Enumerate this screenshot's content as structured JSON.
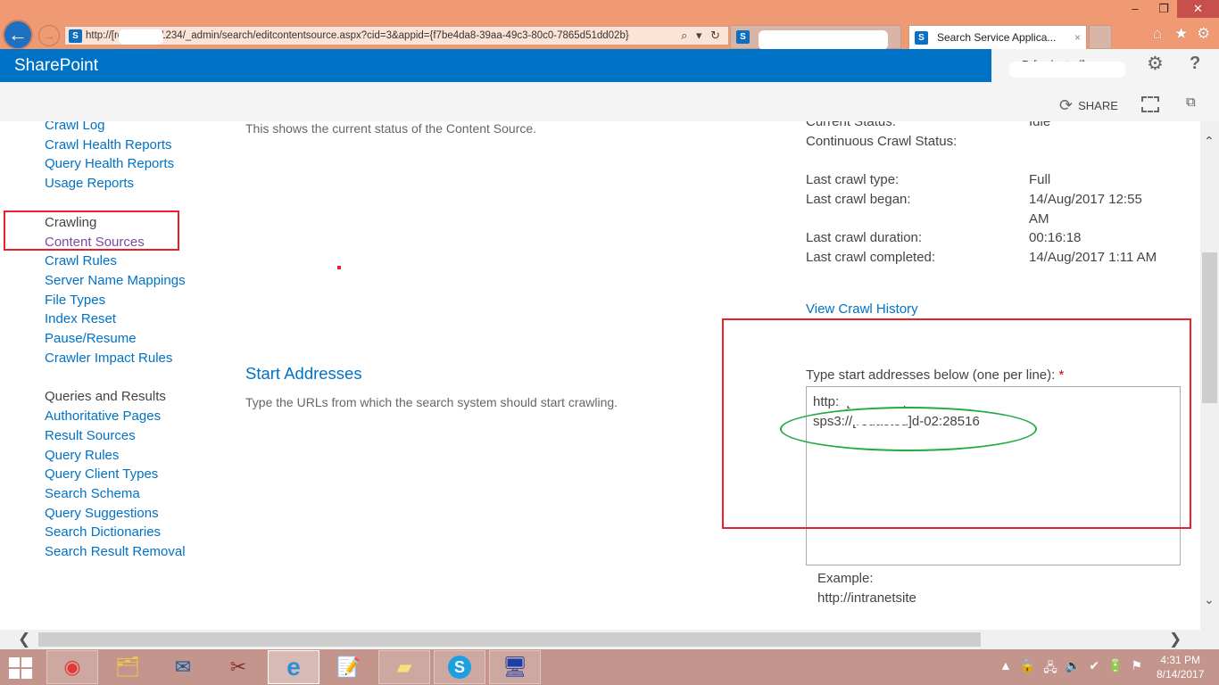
{
  "browser": {
    "url": "http://[redacted]:1234/_admin/search/editcontentsource.aspx?cid=3&appid={f7be4da8-39aa-49c3-80c0-7865d51dd02b}",
    "url_tools": "⌕ ▾ ↻",
    "tabs": [
      {
        "label": "S[redacted] ...",
        "active": false
      },
      {
        "label": "Search Service Applica...",
        "active": true
      }
    ],
    "tab_close": "×",
    "window": {
      "minimize": "–",
      "maximize": "❐",
      "close": "✕"
    },
    "tools": {
      "home": "⌂",
      "favorites": "★",
      "settings": "⚙"
    },
    "back_icon": "←",
    "forward_icon": "→",
    "favicon": "S"
  },
  "suite_bar": {
    "brand": "SharePoint",
    "user": "Pr[redacted]",
    "settings_icon": "⚙",
    "help_icon": "?"
  },
  "action_bar": {
    "share_label": "SHARE",
    "share_icon": "⟳",
    "sync_icon": "⧉"
  },
  "left_nav": {
    "reports": [
      {
        "label": "Crawl Log"
      },
      {
        "label": "Crawl Health Reports"
      },
      {
        "label": "Query Health Reports"
      },
      {
        "label": "Usage Reports"
      }
    ],
    "crawling_heading": "Crawling",
    "crawling": [
      {
        "label": "Content Sources",
        "visited": true
      },
      {
        "label": "Crawl Rules"
      },
      {
        "label": "Server Name Mappings"
      },
      {
        "label": "File Types"
      },
      {
        "label": "Index Reset"
      },
      {
        "label": "Pause/Resume"
      },
      {
        "label": "Crawler Impact Rules"
      }
    ],
    "queries_heading": "Queries and Results",
    "queries": [
      {
        "label": "Authoritative Pages"
      },
      {
        "label": "Result Sources"
      },
      {
        "label": "Query Rules"
      },
      {
        "label": "Query Client Types"
      },
      {
        "label": "Search Schema"
      },
      {
        "label": "Query Suggestions"
      },
      {
        "label": "Search Dictionaries"
      },
      {
        "label": "Search Result Removal"
      }
    ]
  },
  "crawl_status": {
    "description": "This shows the current status of the Content Source.",
    "rows": [
      {
        "label": "Current Status:",
        "value": "Idle"
      },
      {
        "label": "Continuous Crawl Status:",
        "value": ""
      },
      {
        "label": "Last crawl type:",
        "value": "Full"
      },
      {
        "label": "Last crawl began:",
        "value": "14/Aug/2017 12:55 AM"
      },
      {
        "label": "Last crawl duration:",
        "value": "00:16:18"
      },
      {
        "label": "Last crawl completed:",
        "value": "14/Aug/2017 1:11 AM"
      }
    ],
    "view_history_link": "View Crawl History"
  },
  "start_addresses": {
    "title": "Start Addresses",
    "description": "Type the URLs from which the search system should start crawling.",
    "field_label": "Type start addresses below (one per line):",
    "required_marker": "*",
    "value": "http://[redacted]\nsps3://[redacted]d-02:28516",
    "example_label": "Example:",
    "example_value": "http://intranetsite"
  },
  "scrollbars": {
    "up": "⌃",
    "down": "⌄",
    "left": "❮",
    "right": "❯"
  },
  "taskbar": {
    "apps": [
      {
        "name": "chrome",
        "icon": "◉"
      },
      {
        "name": "file-explorer",
        "icon": "🗂"
      },
      {
        "name": "outlook",
        "icon": "✉"
      },
      {
        "name": "snipping-tool",
        "icon": "✂"
      },
      {
        "name": "internet-explorer",
        "icon": "e"
      },
      {
        "name": "notepad",
        "icon": "📝"
      },
      {
        "name": "sticky-notes",
        "icon": "▰"
      },
      {
        "name": "skype",
        "icon": "S"
      },
      {
        "name": "remote-desktop",
        "icon": "🖥"
      }
    ],
    "tray_icons": [
      "▲",
      "🔒",
      "🖧",
      "🔈",
      "✔",
      "🔋",
      "⚑"
    ],
    "time": "4:31 PM",
    "date": "8/14/2017"
  },
  "colors": {
    "accent": "#0072c6",
    "visited_link": "#7c4b9c",
    "annotation_red": "#e8202a",
    "annotation_green": "#22aa44",
    "browser_frame": "#f09a74"
  }
}
